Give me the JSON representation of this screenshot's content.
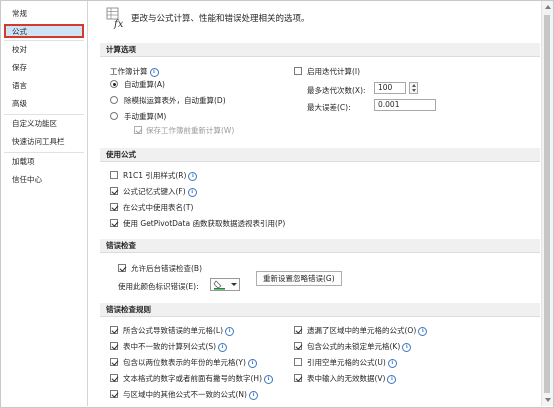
{
  "sidebar": {
    "items": [
      {
        "label": "常规"
      },
      {
        "label": "公式"
      },
      {
        "label": "校对"
      },
      {
        "label": "保存"
      },
      {
        "label": "语言"
      },
      {
        "label": "高级"
      },
      {
        "label": "自定义功能区"
      },
      {
        "label": "快速访问工具栏"
      },
      {
        "label": "加载项"
      },
      {
        "label": "信任中心"
      }
    ]
  },
  "header": {
    "text": "更改与公式计算、性能和错误处理相关的选项。"
  },
  "calc": {
    "title": "计算选项",
    "workbook_calc_label": "工作簿计算",
    "auto": "自动重算(A)",
    "auto_except_tables": "除模拟运算表外，自动重算(D)",
    "manual": "手动重算(M)",
    "recalc_before_save": "保存工作簿前重新计算(W)",
    "enable_iterative": "启用迭代计算(I)",
    "max_iterations_label": "最多迭代次数(X):",
    "max_iterations_value": "100",
    "max_change_label": "最大误差(C):",
    "max_change_value": "0.001"
  },
  "formulas": {
    "title": "使用公式",
    "r1c1": "R1C1 引用样式(R)",
    "autocomplete": "公式记忆式键入(F)",
    "table_names": "在公式中使用表名(T)",
    "getpivotdata": "使用 GetPivotData 函数获取数据透视表引用(P)"
  },
  "error_checking": {
    "title": "错误检查",
    "enable_background": "允许后台错误检查(B)",
    "indicator_color_label": "使用此颜色标识错误(E):",
    "reset_button": "重新设置忽略错误(G)"
  },
  "rules": {
    "title": "错误检查规则",
    "left": [
      "所含公式导致错误的单元格(L)",
      "表中不一致的计算列公式(S)",
      "包含以两位数表示的年份的单元格(Y)",
      "文本格式的数字或者前面有撇号的数字(H)",
      "与区域中的其他公式不一致的公式(N)"
    ],
    "right": [
      "遗漏了区域中的单元格的公式(O)",
      "包含公式的未锁定单元格(K)",
      "引用空单元格的公式(U)",
      "表中输入的无效数据(V)"
    ]
  },
  "colors": {
    "accent_border": "#d23a2c",
    "selected_bg": "#cfe3f6",
    "info_icon": "#3b78c4"
  }
}
